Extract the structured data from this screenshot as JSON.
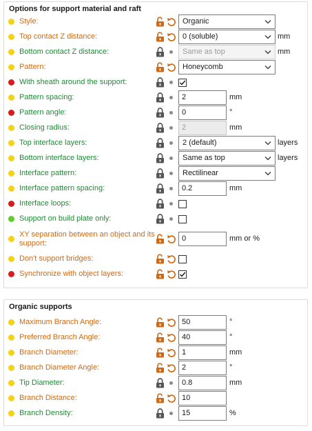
{
  "support": {
    "title": "Options for support material and raft",
    "rows": [
      {
        "label": "Style:",
        "value": "Organic"
      },
      {
        "label": "Top contact Z distance:",
        "value": "0 (soluble)",
        "unit": "mm"
      },
      {
        "label": "Bottom contact Z distance:",
        "value": "Same as top",
        "unit": "mm"
      },
      {
        "label": "Pattern:",
        "value": "Honeycomb"
      },
      {
        "label": "With sheath around the support:",
        "checked": true
      },
      {
        "label": "Pattern spacing:",
        "value": "2",
        "unit": "mm"
      },
      {
        "label": "Pattern angle:",
        "value": "0",
        "unit": "°"
      },
      {
        "label": "Closing radius:",
        "value": "2",
        "unit": "mm"
      },
      {
        "label": "Top interface layers:",
        "value": "2 (default)",
        "unit": "layers"
      },
      {
        "label": "Bottom interface layers:",
        "value": "Same as top",
        "unit": "layers"
      },
      {
        "label": "Interface pattern:",
        "value": "Rectilinear"
      },
      {
        "label": "Interface pattern spacing:",
        "value": "0.2",
        "unit": "mm"
      },
      {
        "label": "Interface loops:",
        "checked": false
      },
      {
        "label": "Support on build plate only:",
        "checked": false
      },
      {
        "label": "XY separation between an object and its support:",
        "value": "0",
        "unit": "mm or %"
      },
      {
        "label": "Don't support bridges:",
        "checked": false
      },
      {
        "label": "Synchronize with object layers:",
        "checked": true
      }
    ]
  },
  "organic": {
    "title": "Organic supports",
    "rows": [
      {
        "label": "Maximum Branch Angle:",
        "value": "50",
        "unit": "°"
      },
      {
        "label": "Preferred Branch Angle:",
        "value": "40",
        "unit": "°"
      },
      {
        "label": "Branch Diameter:",
        "value": "1",
        "unit": "mm"
      },
      {
        "label": "Branch Diameter Angle:",
        "value": "2",
        "unit": "°"
      },
      {
        "label": "Tip Diameter:",
        "value": "0.8",
        "unit": "mm"
      },
      {
        "label": "Branch Distance:",
        "value": "10"
      },
      {
        "label": "Branch Density:",
        "value": "15",
        "unit": "%"
      }
    ]
  },
  "colors": {
    "label_green": "#208a35",
    "label_orange": "#d2690f",
    "dot_yellow": "#f2d31a",
    "dot_red": "#d41d1d",
    "dot_green": "#5fcf2a",
    "lock_open_orange": "#d2690f",
    "lock_closed_gray": "#555555"
  },
  "icons": [
    "open-lock-icon",
    "closed-lock-icon",
    "revert-arrow-icon",
    "bullet-icon",
    "chevron-down-icon",
    "checkmark-icon",
    "mode-dot-icon"
  ]
}
